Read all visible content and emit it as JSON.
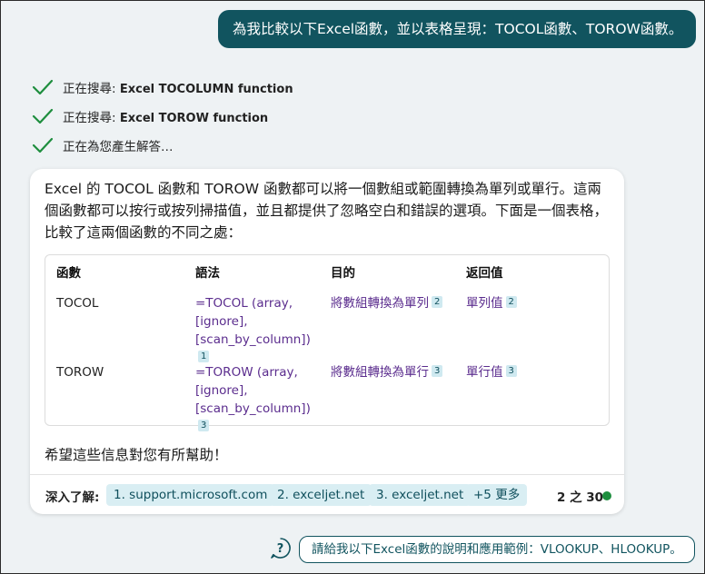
{
  "user_message": "為我比較以下Excel函數，並以表格呈現：TOCOL函數、TOROW函數。",
  "progress": [
    {
      "prefix": "正在搜尋: ",
      "query": "Excel TOCOLUMN function"
    },
    {
      "prefix": "正在搜尋: ",
      "query": "Excel TOROW function"
    },
    {
      "prefix": "正在為您產生解答…",
      "query": ""
    }
  ],
  "answer": {
    "intro": "Excel 的 TOCOL 函數和 TOROW 函數都可以將一個數組或範圍轉換為單列或單行。這兩個函數都可以按行或按列掃描值，並且都提供了忽略空白和錯誤的選項。下面是一個表格，比較了這兩個函數的不同之處：",
    "table": {
      "headers": [
        "函數",
        "語法",
        "目的",
        "返回值"
      ],
      "rows": [
        {
          "func": "TOCOL",
          "syntax_lines": [
            "=TOCOL (array,",
            "[ignore],",
            "[scan_by_column])"
          ],
          "syntax_ref": "1",
          "purpose": "將數組轉換為單列",
          "purpose_ref": "2",
          "returns": "單列值",
          "returns_ref": "2"
        },
        {
          "func": "TOROW",
          "syntax_lines": [
            "=TOROW (array,",
            "[ignore],",
            "[scan_by_column])"
          ],
          "syntax_ref": "3",
          "purpose": "將數組轉換為單行",
          "purpose_ref": "3",
          "returns": "單行值",
          "returns_ref": "3"
        }
      ]
    },
    "closing": "希望這些信息對您有所幫助！"
  },
  "learn_more": {
    "label": "深入了解:",
    "links": [
      "1. support.microsoft.com",
      "2. exceljet.net",
      "3. exceljet.net",
      "+5 更多"
    ]
  },
  "counter": "2 之 30",
  "status_color": "#1e8e3e",
  "suggestion": "請給我以下Excel函數的說明和應用範例：VLOOKUP、HLOOKUP。",
  "colors": {
    "accent": "#11545f",
    "link_purple": "#5b2d8e",
    "chip_bg": "#d9eef3"
  }
}
